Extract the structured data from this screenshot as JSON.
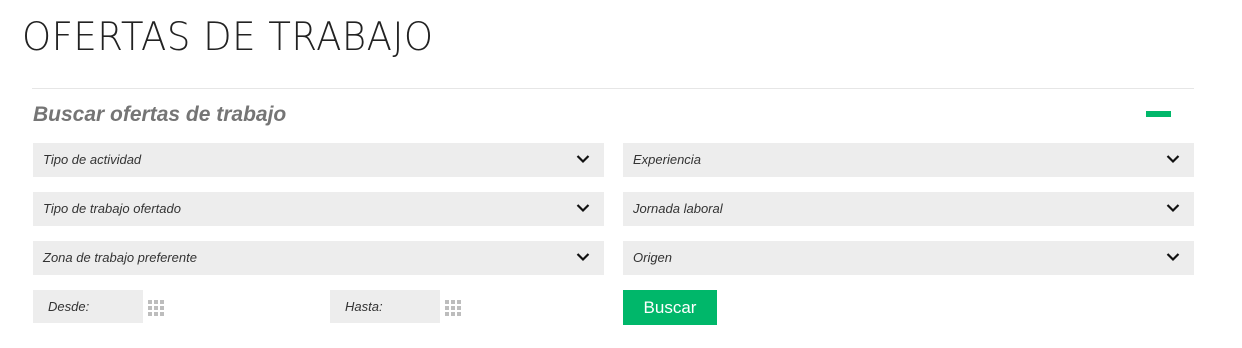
{
  "page": {
    "title": "OFERTAS DE TRABAJO"
  },
  "search": {
    "title": "Buscar ofertas de trabajo",
    "collapse_icon": "minus-icon",
    "accent_color": "#00b76a",
    "filters_left": [
      {
        "label": "Tipo de actividad"
      },
      {
        "label": "Tipo de trabajo ofertado"
      },
      {
        "label": "Zona de trabajo preferente"
      }
    ],
    "filters_right": [
      {
        "label": "Experiencia"
      },
      {
        "label": "Jornada laboral"
      },
      {
        "label": "Origen"
      }
    ],
    "date_from": {
      "placeholder": "Desde:",
      "icon": "calendar-icon"
    },
    "date_to": {
      "placeholder": "Hasta:",
      "icon": "calendar-icon"
    },
    "submit_label": "Buscar"
  }
}
